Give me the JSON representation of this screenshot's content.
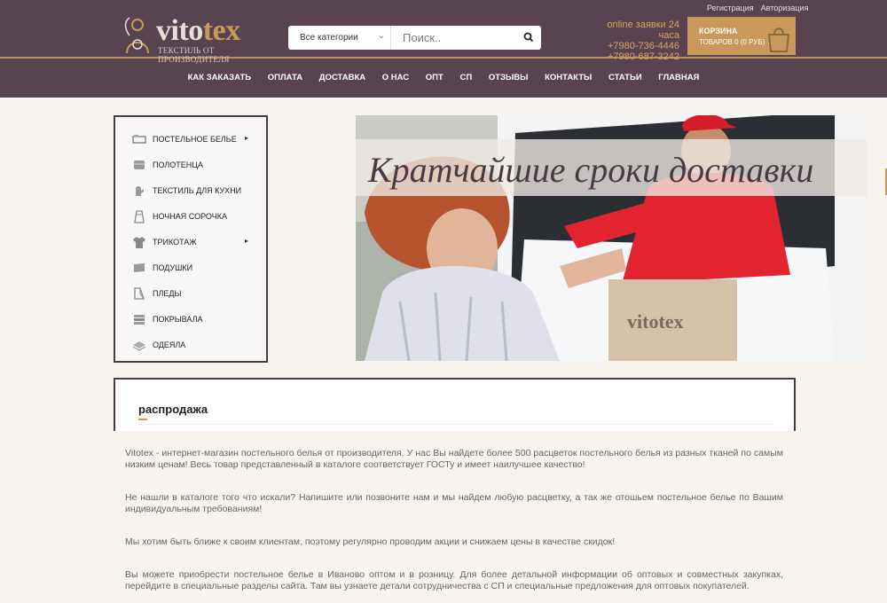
{
  "header": {
    "logo": {
      "word_a": "vito",
      "word_b": "tex",
      "tagline": "ТЕКСТИЛЬ ОТ ПРОИЗВОДИТЕЛЯ"
    },
    "search": {
      "category": "Все категории",
      "placeholder": "Поиск.."
    },
    "phones": [
      "online заявки 24 часа",
      "+7980-736-4446",
      "+7980-687-3242"
    ],
    "links": [
      "Регистрация",
      "Авторизация"
    ],
    "cart": {
      "label": "КОРЗИНА",
      "summary": "ТОВАРОВ 0 (0 РУБ)"
    }
  },
  "nav": [
    "КАК ЗАКАЗАТЬ",
    "ОПЛАТА",
    "ДОСТАВКА",
    "О НАС",
    "ОПТ",
    "СП",
    "ОТЗЫВЫ",
    "КОНТАКТЫ",
    "СТАТЬИ",
    "ГЛАВНАЯ"
  ],
  "sidebar": {
    "items": [
      {
        "label": "ПОСТЕЛЬНОЕ БЕЛЬЕ",
        "icon": "bed-icon",
        "submenu": true
      },
      {
        "label": "ПОЛОТЕНЦА",
        "icon": "towel-icon",
        "submenu": false
      },
      {
        "label": "ТЕКСТИЛЬ ДЛЯ КУХНИ",
        "icon": "mitten-icon",
        "submenu": false
      },
      {
        "label": "НОЧНАЯ СОРОЧКА",
        "icon": "nightgown-icon",
        "submenu": false
      },
      {
        "label": "ТРИКОТАЖ",
        "icon": "tshirt-icon",
        "submenu": true
      },
      {
        "label": "ПОДУШКИ",
        "icon": "pillow-icon",
        "submenu": false
      },
      {
        "label": "ПЛЕДЫ",
        "icon": "blanket-icon",
        "submenu": false
      },
      {
        "label": "ПОКРЫВАЛА",
        "icon": "bedspread-icon",
        "submenu": false
      },
      {
        "label": "ОДЕЯЛА",
        "icon": "duvet-icon",
        "submenu": false
      }
    ]
  },
  "banner": {
    "caption": "Кратчайшие сроки доставки",
    "box_logo": "vitotex"
  },
  "sale": {
    "title": "распродажа"
  },
  "paragraphs": [
    "Vitotex - интернет-магазин постельного белья от производителя. У нас Вы найдете более 500 расцветок постельного белья из разных тканей по самым низким ценам! Весь товар представленный в каталоге соответствует ГОСТу и имеет наилучшее качество!",
    "Не нашли в каталоге того что искали? Напишите или позвоните нам и мы найдем любую расцветку, а так же отошьем постельное белье по Вашим индивидуальным требованиям!",
    "Мы хотим быть ближе к своим клиентам, поэтому регулярно проводим акции и снижаем цены в качестве скидок!",
    "Вы можете приобрести постельное белье в Иваново оптом и в розницу. Для более детальной информации об оптовых и совместных закупках, перейдите в  специальные разделы сайта. Там вы узнаете детали сотрудничества с СП и  специальные предложения для оптовых покупателей."
  ],
  "colors": {
    "header": "#5a4350",
    "accent": "#c9985a",
    "border": "#4a3a44"
  }
}
